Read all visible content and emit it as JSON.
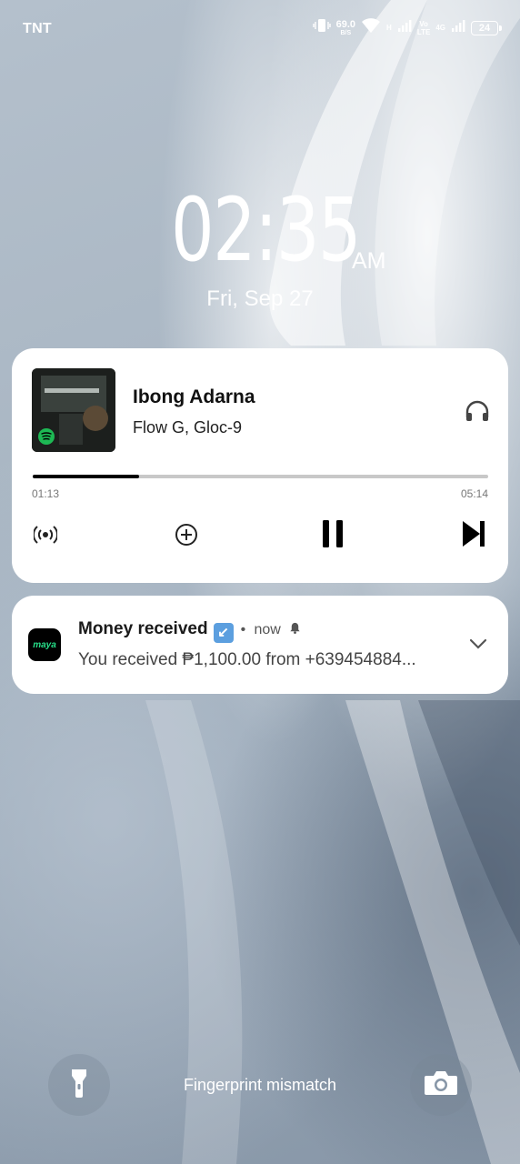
{
  "status_bar": {
    "carrier": "TNT",
    "net_speed_value": "69.0",
    "net_speed_unit": "B/S",
    "volte_top": "Vo",
    "volte_bottom": "LTE",
    "network_h": "H",
    "network_4g": "4G",
    "battery": "24",
    "icons": [
      "vibrate-icon",
      "wifi-icon",
      "signal-icon",
      "battery-icon"
    ]
  },
  "clock": {
    "time": "02:35",
    "ampm": "AM",
    "date": "Fri, Sep 27"
  },
  "media": {
    "title": "Ibong Adarna",
    "artist": "Flow G, Gloc-9",
    "elapsed": "01:13",
    "total": "05:14",
    "progress_fraction": 0.233,
    "source_icon": "spotify-icon",
    "output_icon": "headphones-icon",
    "controls": [
      "broadcast-icon",
      "add-icon",
      "pause-icon",
      "skip-next-icon"
    ],
    "accent_color": "#1db954"
  },
  "notification": {
    "app_icon_text": "maya",
    "title": "Money received",
    "emoji": "↙",
    "separator": "•",
    "time": "now",
    "body": "You received ₱1,100.00 from +639454884...",
    "app_color": "#27e08a"
  },
  "bottom": {
    "fingerprint_message": "Fingerprint mismatch",
    "left_icon": "flashlight-icon",
    "right_icon": "camera-icon"
  }
}
